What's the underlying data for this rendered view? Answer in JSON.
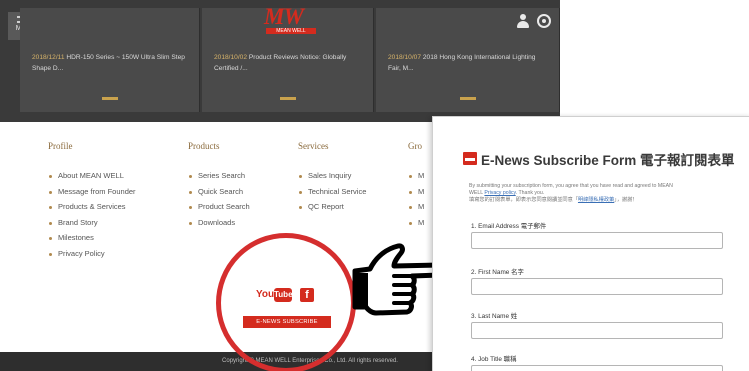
{
  "site": {
    "menu_label": "MENU",
    "logo_text": "MW",
    "logo_sub": "MEAN WELL",
    "news": [
      {
        "date": "2018/12/11",
        "text": "HDR-150 Series ~ 150W Ultra Slim Step Shape D..."
      },
      {
        "date": "2018/10/02",
        "text": "Product Reviews Notice: Globally Certified /..."
      },
      {
        "date": "2018/10/07",
        "text": "2018 Hong Kong International Lighting Fair, M..."
      }
    ],
    "columns": [
      {
        "title": "Profile",
        "items": [
          "About MEAN WELL",
          "Message from Founder",
          "Products & Services",
          "Brand Story",
          "Milestones",
          "Privacy Policy"
        ]
      },
      {
        "title": "Products",
        "items": [
          "Series Search",
          "Quick Search",
          "Product Search",
          "Downloads"
        ]
      },
      {
        "title": "Services",
        "items": [
          "Sales Inquiry",
          "Technical Service",
          "QC Report"
        ]
      },
      {
        "title": "Gro",
        "items": [
          "M",
          "M",
          "M",
          "M"
        ]
      }
    ],
    "youtube_you": "You",
    "youtube_tube": "Tube",
    "facebook_glyph": "f",
    "enews_button": "E-NEWS SUBSCRIBE",
    "footer": "Copyright © MEAN WELL Enterprises Co., Ltd. All rights reserved."
  },
  "form": {
    "title": "E-News Subscribe Form 電子報訂閱表單",
    "intro_line1": "By submitting your subscription form, you agree that you have read and agreed to MEAN",
    "intro_line2_prefix": "WELL",
    "intro_link": "Privacy policy",
    "intro_line2_suffix": ". Thank you.",
    "intro_line3_prefix": "填寫您的訂閱表單，即表示您同意閱讀並同意「",
    "intro_link_zh": "明緯隱私權政策",
    "intro_line3_suffix": "」，謝謝！",
    "fields": [
      {
        "label": "1. Email Address 電子郵件"
      },
      {
        "label": "2. First Name 名字"
      },
      {
        "label": "3. Last Name 姓"
      },
      {
        "label": "4. Job Title 職稱"
      }
    ]
  },
  "colors": {
    "brand_red": "#d42b1e",
    "gold": "#8a6a3c",
    "dark_band": "#3a3a3a"
  }
}
